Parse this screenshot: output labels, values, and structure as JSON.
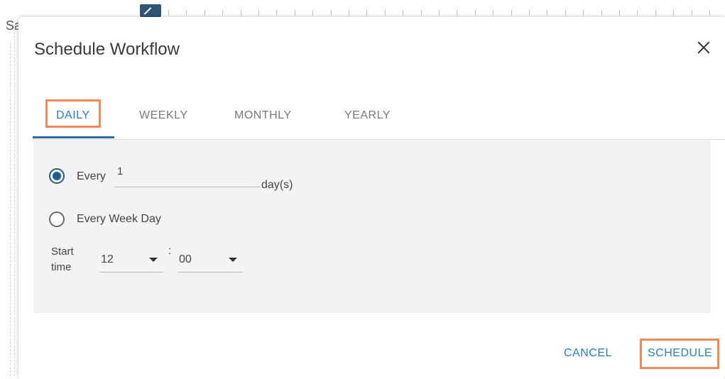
{
  "background": {
    "title_fragment": "Sa"
  },
  "dialog": {
    "title": "Schedule Workflow",
    "tabs": [
      {
        "label": "DAILY",
        "active": true
      },
      {
        "label": "WEEKLY",
        "active": false
      },
      {
        "label": "MONTHLY",
        "active": false
      },
      {
        "label": "YEARLY",
        "active": false
      }
    ],
    "options": {
      "every_label": "Every",
      "every_value": "1",
      "every_unit": "day(s)",
      "every_selected": true,
      "weekday_label": "Every Week Day",
      "weekday_selected": false
    },
    "start_time": {
      "label_line1": "Start",
      "label_line2": "time",
      "hour": "12",
      "separator": ":",
      "minute": "00"
    },
    "buttons": {
      "cancel": "CANCEL",
      "schedule": "SCHEDULE"
    }
  },
  "colors": {
    "accent": "#2b7cc4",
    "highlight": "#ef8a5a",
    "panel": "#f3f3f3"
  }
}
